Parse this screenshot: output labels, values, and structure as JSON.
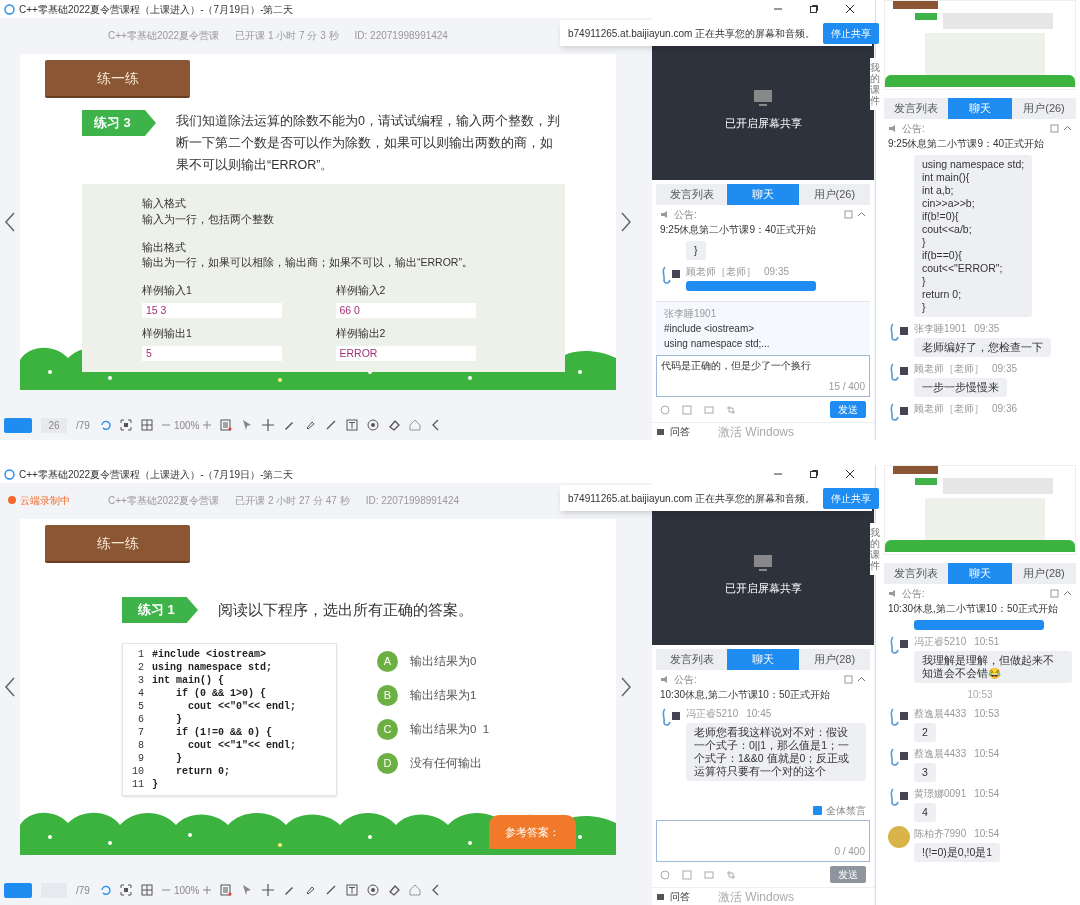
{
  "screens": [
    {
      "title": "C++零基础2022夏令营课程（上课进入）-（7月19日）-第二天",
      "header_info": [
        "C++零基础2022夏令营课",
        "已开课 1 小时 7 分 3 秒",
        "ID: 22071998991424"
      ],
      "share_bar": {
        "text": "b74911265.at.baijiayun.com 正在共享您的屏幕和音频。",
        "button": "停止共享"
      },
      "slide": {
        "kind": "problem",
        "sign": "练一练",
        "badge": "练习 3",
        "question": "我们知道除法运算的除数不能为0，请试试编程，输入两个整数，判断一下第二个数是否可以作为除数，如果可以则输出两数的商，如果不可以则输出“ERROR”。",
        "format": [
          {
            "heading": "输入格式",
            "text": "输入为一行，包括两个整数"
          },
          {
            "heading": "输出格式",
            "text": "输出为一行，如果可以相除，输出商；如果不可以，输出“ERROR”。"
          }
        ],
        "samples": [
          {
            "label": "样例输入1",
            "value": "15 3"
          },
          {
            "label": "样例输入2",
            "value": "66 0"
          },
          {
            "label": "样例输出1",
            "value": "5"
          },
          {
            "label": "样例输出2",
            "value": "ERROR"
          }
        ]
      },
      "toolbar": {
        "page": "26",
        "total": "/79",
        "zoom": "100%"
      },
      "side_tab": "我的课件",
      "video": {
        "label": "已开启屏幕共享"
      },
      "tabs": [
        {
          "label": "发言列表",
          "selected": false
        },
        {
          "label": "聊天",
          "selected": true
        },
        {
          "label": "用户(26)",
          "selected": false
        }
      ],
      "notice": {
        "label": "公告:",
        "text": "9:25休息第二小节课9：40正式开始"
      },
      "messages": [
        {
          "kind": "fragment",
          "text": "}",
          "highlighted": false
        },
        {
          "kind": "member",
          "sender": "顾老师［老师］",
          "time": "09:35",
          "highlighted": true
        }
      ],
      "quote": {
        "sender": "张李睡1901",
        "text": "#include <iostream>\nusing namespace std;..."
      },
      "input": {
        "value": "代码是正确的，但是少了一个换行",
        "counter": "15 / 400"
      },
      "send_button": {
        "label": "发送",
        "disabled": false
      },
      "bottom": {
        "qa": "问答",
        "watermark": "激活 Windows"
      },
      "side": {
        "tabs": [
          {
            "label": "发言列表",
            "selected": false
          },
          {
            "label": "聊天",
            "selected": true
          },
          {
            "label": "用户(26)",
            "selected": false
          }
        ],
        "notice": {
          "label": "公告:",
          "text": "9:25休息第二小节课9：40正式开始"
        },
        "messages": [
          {
            "kind": "fragment",
            "text": "using namespace std;\nint main(){\nint a,b;\ncin>>a>>b;\nif(b!=0){\ncout<<a/b;\n}\nif(b==0){\ncout<<\"ERROR\";\n}\nreturn 0;\n}",
            "highlighted": false
          },
          {
            "kind": "member",
            "sender": "张李睡1901",
            "time": "09:35",
            "text": "老师编好了，您检查一下",
            "highlighted": false
          },
          {
            "kind": "member",
            "sender": "顾老师［老师］",
            "time": "09:35",
            "text": "一步一步慢慢来",
            "highlighted": false
          },
          {
            "kind": "member",
            "sender": "顾老师［老师］",
            "time": "09:36"
          }
        ]
      }
    },
    {
      "title": "C++零基础2022夏令营课程（上课进入）-（7月19日）-第二天",
      "recording": "云端录制中",
      "header_info": [
        "C++零基础2022夏令营课",
        "已开课 2 小时 27 分 47 秒",
        "ID: 22071998991424"
      ],
      "share_bar": {
        "text": "b74911265.at.baijiayun.com 正在共享您的屏幕和音频。",
        "button": "停止共享"
      },
      "slide": {
        "kind": "quiz",
        "sign": "练一练",
        "badge": "练习 1",
        "question": "阅读以下程序，选出所有正确的答案。",
        "code": [
          {
            "number": "1",
            "text": "#include <iostream>"
          },
          {
            "number": "2",
            "text": "using namespace std;"
          },
          {
            "number": "3",
            "text": "int main() {"
          },
          {
            "number": "4",
            "text": "    if (0 && 1>0) {"
          },
          {
            "number": "5",
            "text": "      cout <<\"0\"<< endl;"
          },
          {
            "number": "6",
            "text": "    }"
          },
          {
            "number": "7",
            "text": "    if (1!=0 && 0) {"
          },
          {
            "number": "8",
            "text": "      cout <<\"1\"<< endl;"
          },
          {
            "number": "9",
            "text": "    }"
          },
          {
            "number": "10",
            "text": "    return 0;"
          },
          {
            "number": "11",
            "text": "}"
          }
        ],
        "options": [
          {
            "letter": "A",
            "text": "输出结果为0"
          },
          {
            "letter": "B",
            "text": "输出结果为1"
          },
          {
            "letter": "C",
            "text": "输出结果为0  1"
          },
          {
            "letter": "D",
            "text": "没有任何输出"
          }
        ],
        "answer_button": "参考答案："
      },
      "toolbar": {
        "total": "/79",
        "zoom": "100%"
      },
      "side_tab": "我的课件",
      "video": {
        "label": "已开启屏幕共享"
      },
      "tabs": [
        {
          "label": "发言列表",
          "selected": false
        },
        {
          "label": "聊天",
          "selected": true
        },
        {
          "label": "用户(28)",
          "selected": false
        }
      ],
      "notice": {
        "label": "公告:",
        "text": "10:30休息,第二小节课10：50正式开始"
      },
      "messages": [
        {
          "kind": "member",
          "sender": "冯正睿5210",
          "time": "10:45",
          "text": "老师您看我这样说对不对：假设一个式子：0||1，那么值是1；一个式子：1&&0 值就是0；反正或运算符只要有一个对的这个",
          "highlighted": false
        }
      ],
      "mute_all": {
        "label": "全体禁言",
        "checked": true
      },
      "input": {
        "counter": "0 / 400"
      },
      "send_button": {
        "label": "发送",
        "disabled": true
      },
      "bottom": {
        "qa": "问答",
        "watermark": "激活 Windows"
      },
      "side": {
        "tabs": [
          {
            "label": "发言列表",
            "selected": false
          },
          {
            "label": "聊天",
            "selected": true
          },
          {
            "label": "用户(28)",
            "selected": false
          }
        ],
        "notice": {
          "label": "公告:",
          "text": "10:30休息,第二小节课10：50正式开始"
        },
        "messages": [
          {
            "kind": "fragment",
            "highlighted": true
          },
          {
            "kind": "member",
            "sender": "冯正睿5210",
            "time": "10:51",
            "text": "我理解是理解，但做起来不知道会不会错😂",
            "highlighted": false
          },
          {
            "kind": "divider",
            "text": "10:53"
          },
          {
            "kind": "member",
            "sender": "蔡逸晨4433",
            "time": "10:53",
            "text": "2",
            "highlighted": false
          },
          {
            "kind": "member",
            "sender": "蔡逸晨4433",
            "time": "10:54",
            "text": "3",
            "highlighted": false
          },
          {
            "kind": "member",
            "sender": "黄璟娜0091",
            "time": "10:54",
            "text": "4",
            "highlighted": false
          },
          {
            "kind": "photo",
            "sender": "陈柏齐7990",
            "time": "10:54",
            "text": "!(!=0)是0,!0是1",
            "highlighted": false
          }
        ]
      }
    }
  ]
}
